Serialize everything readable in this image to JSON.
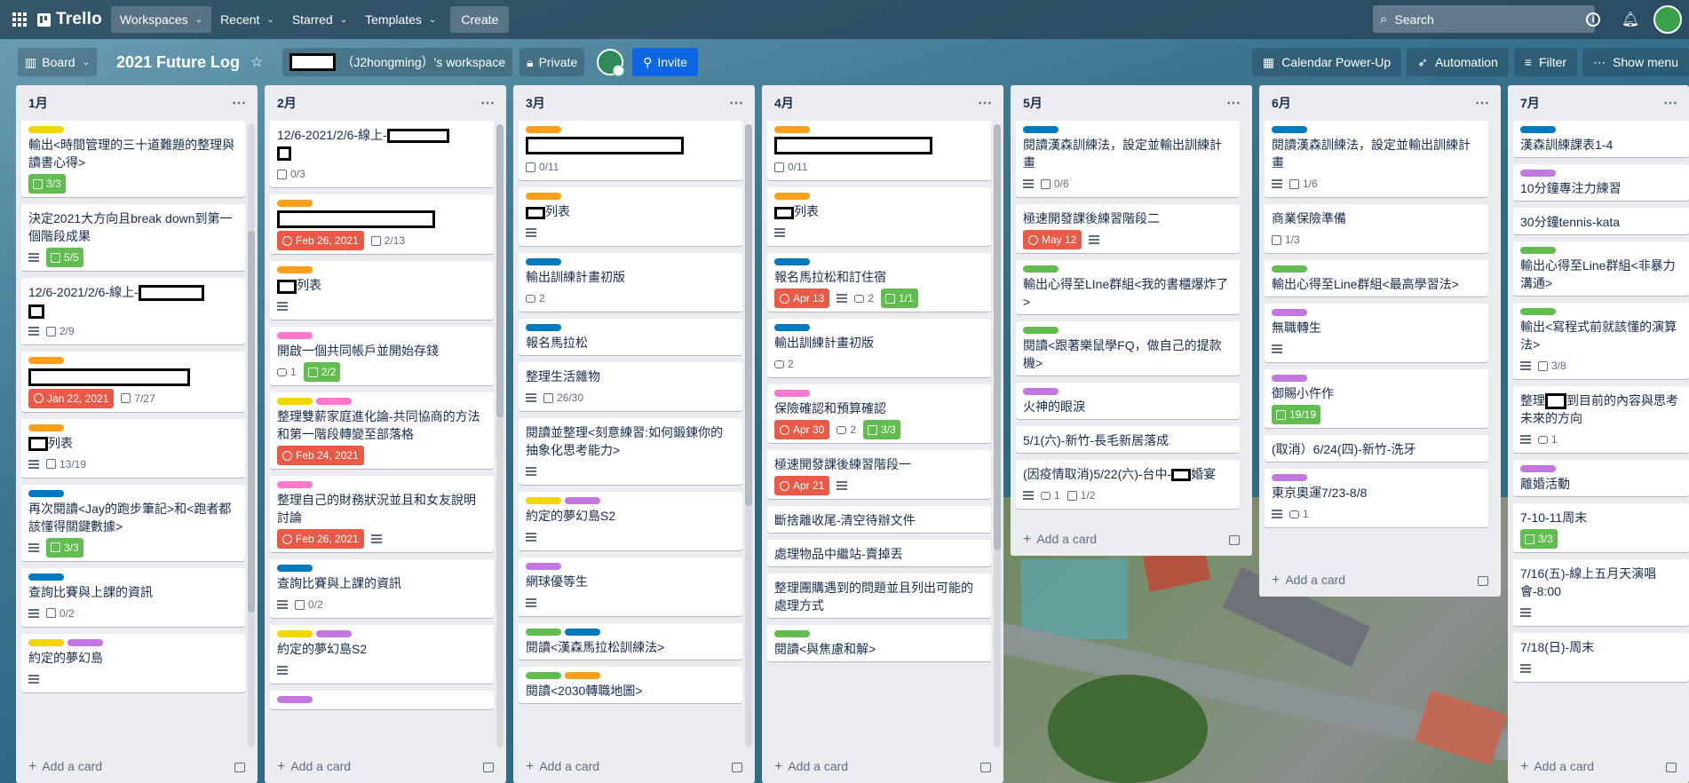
{
  "header": {
    "app_name": "Trello",
    "nav": [
      "Workspaces",
      "Recent",
      "Starred",
      "Templates"
    ],
    "create_label": "Create",
    "search_placeholder": "Search"
  },
  "board": {
    "view_label": "Board",
    "title": "2021 Future Log",
    "workspace_label": "（J2hongming）'s workspace",
    "visibility": "Private",
    "invite_label": "Invite",
    "right_buttons": [
      "Calendar Power-Up",
      "Automation",
      "Filter",
      "Show menu"
    ]
  },
  "add_card_label": "Add a card",
  "colors": {
    "orange": "#ff9f1a",
    "yellow": "#f2d600",
    "blue": "#0079bf",
    "green": "#61bd4f",
    "purple": "#c377e0",
    "pink": "#ff78cb",
    "red": "#eb5a46"
  },
  "lists": [
    {
      "title": "1月",
      "cards": [
        {
          "labels": [
            "yellow"
          ],
          "title": "輸出<時間管理的三十道難題的整理與讀書心得>",
          "checklist": "3/3",
          "checklist_done": true
        },
        {
          "labels": [],
          "title": "決定2021大方向且break down到第一個階段成果",
          "desc": true,
          "checklist": "5/5",
          "checklist_done": true
        },
        {
          "labels": [],
          "title": "12/6-2021/2/6-線上-",
          "redacted": [
            74,
            18
          ],
          "redacted2": [
            18,
            16
          ],
          "desc": true,
          "checklist": "2/9"
        },
        {
          "labels": [
            "orange"
          ],
          "title": "",
          "redacted_full": [
            182,
            18
          ],
          "due": "Jan 22, 2021",
          "checklist": "7/27"
        },
        {
          "labels": [
            "orange"
          ],
          "title": "列表",
          "redacted_pre": [
            22,
            16
          ],
          "desc": true,
          "checklist": "13/19"
        },
        {
          "labels": [
            "blue"
          ],
          "title": "再次閱讀<Jay的跑步筆記>和<跑者都該懂得關鍵數據>",
          "desc": true,
          "checklist": "3/3",
          "checklist_done": true
        },
        {
          "labels": [
            "blue"
          ],
          "title": "查詢比賽與上課的資訊",
          "desc": true,
          "checklist": "0/2"
        },
        {
          "labels": [
            "yellow",
            "purple"
          ],
          "title": "約定的夢幻島",
          "desc": true
        }
      ]
    },
    {
      "title": "2月",
      "cards": [
        {
          "labels": [],
          "title": "12/6-2021/2/6-線上-",
          "redacted": [
            70,
            16
          ],
          "redacted2": [
            16,
            16
          ],
          "checklist": "0/3"
        },
        {
          "labels": [
            "orange"
          ],
          "title": "",
          "redacted_full": [
            178,
            16
          ],
          "due": "Feb 26, 2021",
          "checklist": "2/13"
        },
        {
          "labels": [
            "orange"
          ],
          "title": "列表",
          "redacted_pre": [
            22,
            16
          ],
          "desc": true
        },
        {
          "labels": [
            "pink"
          ],
          "title": "開啟一個共同帳戶並開始存錢",
          "comments": "1",
          "checklist": "2/2",
          "checklist_done": true
        },
        {
          "labels": [
            "yellow",
            "pink"
          ],
          "title": "整理雙薪家庭進化論-共同協商的方法和第一階段轉變至部落格",
          "due": "Feb 24, 2021"
        },
        {
          "labels": [
            "pink"
          ],
          "title": "整理自己的財務狀況並且和女友說明討論",
          "due": "Feb 26, 2021",
          "desc": true
        },
        {
          "labels": [
            "blue"
          ],
          "title": "查詢比賽與上課的資訊",
          "desc": true,
          "checklist": "0/2"
        },
        {
          "labels": [
            "yellow",
            "purple"
          ],
          "title": "約定的夢幻島S2",
          "desc": true
        },
        {
          "labels": [
            "purple"
          ],
          "title": ""
        }
      ]
    },
    {
      "title": "3月",
      "cards": [
        {
          "labels": [
            "orange"
          ],
          "title": "",
          "redacted_full": [
            178,
            16
          ],
          "checklist": "0/11"
        },
        {
          "labels": [
            "orange"
          ],
          "title": "列表",
          "redacted_pre": [
            22,
            14
          ],
          "desc": true
        },
        {
          "labels": [
            "blue"
          ],
          "title": "輸出訓練計畫初版",
          "comments": "2"
        },
        {
          "labels": [
            "blue"
          ],
          "title": "報名馬拉松"
        },
        {
          "labels": [],
          "title": "整理生活雜物",
          "desc": true,
          "checklist": "26/30"
        },
        {
          "labels": [],
          "title": "閱讀並整理<刻意練習:如何鍛鍊你的抽象化思考能力>",
          "desc": true
        },
        {
          "labels": [
            "yellow",
            "purple"
          ],
          "title": "約定的夢幻島S2",
          "desc": true
        },
        {
          "labels": [
            "purple"
          ],
          "title": "網球優等生",
          "desc": true
        },
        {
          "labels": [
            "green",
            "blue"
          ],
          "title": "閱讀<漢森馬拉松訓練法>"
        },
        {
          "labels": [
            "green",
            "orange"
          ],
          "title": "閱讀<2030轉職地圖>"
        }
      ]
    },
    {
      "title": "4月",
      "cards": [
        {
          "labels": [
            "orange"
          ],
          "title": "",
          "redacted_full": [
            178,
            16
          ],
          "checklist": "0/11"
        },
        {
          "labels": [
            "orange"
          ],
          "title": "列表",
          "redacted_pre": [
            22,
            14
          ],
          "desc": true
        },
        {
          "labels": [
            "blue"
          ],
          "title": "報名馬拉松和訂住宿",
          "due": "Apr 13",
          "desc": true,
          "comments": "2",
          "checklist": "1/1",
          "checklist_done": true
        },
        {
          "labels": [
            "blue"
          ],
          "title": "輸出訓練計畫初版",
          "comments": "2"
        },
        {
          "labels": [
            "pink"
          ],
          "title": "保險確認和預算確認",
          "due": "Apr 30",
          "comments": "2",
          "checklist": "3/3",
          "checklist_done": true
        },
        {
          "labels": [],
          "title": "極速開發課後練習階段一",
          "due": "Apr 21",
          "desc": true
        },
        {
          "labels": [],
          "title": "斷捨離收尾-清空待辦文件"
        },
        {
          "labels": [],
          "title": "處理物品中繼站-賣掉丟"
        },
        {
          "labels": [],
          "title": "整理團購遇到的問題並且列出可能的處理方式"
        },
        {
          "labels": [
            "green"
          ],
          "title": "閱讀<與焦慮和解>"
        }
      ]
    },
    {
      "title": "5月",
      "cards": [
        {
          "labels": [
            "blue"
          ],
          "title": "閱讀漢森訓練法，設定並輸出訓練計畫",
          "desc": true,
          "checklist": "0/6"
        },
        {
          "labels": [],
          "title": "極速開發課後練習階段二",
          "due": "May 12",
          "desc": true
        },
        {
          "labels": [
            "green"
          ],
          "title": "輸出心得至LIne群組<我的書櫃爆炸了>"
        },
        {
          "labels": [
            "green"
          ],
          "title": "閱讀<跟著樂鼠學FQ，做自己的提款機>"
        },
        {
          "labels": [
            "purple"
          ],
          "title": "火神的眼淚"
        },
        {
          "labels": [],
          "title": "5/1(六)-新竹-長毛新居落成"
        },
        {
          "labels": [],
          "title": "(因疫情取消)5/22(六)-台中-",
          "title_after": "婚宴",
          "redacted_mid": [
            22,
            14
          ],
          "desc": true,
          "comments": "1",
          "checklist": "1/2"
        }
      ]
    },
    {
      "title": "6月",
      "cards": [
        {
          "labels": [
            "blue"
          ],
          "title": "閱讀漢森訓練法，設定並輸出訓練計畫",
          "desc": true,
          "checklist": "1/6"
        },
        {
          "labels": [],
          "title": "商業保險準備",
          "checklist": "1/3"
        },
        {
          "labels": [
            "green"
          ],
          "title": "輸出心得至Line群組<最高學習法>"
        },
        {
          "labels": [
            "purple"
          ],
          "title": "無職轉生",
          "desc": true
        },
        {
          "labels": [
            "purple"
          ],
          "title": "御賜小仵作",
          "checklist": "19/19",
          "checklist_done": true
        },
        {
          "labels": [],
          "title": "(取消）6/24(四)-新竹-洗牙"
        },
        {
          "labels": [
            "purple"
          ],
          "title": "東京奧運7/23-8/8",
          "desc": true,
          "comments": "1"
        }
      ]
    },
    {
      "title": "7月",
      "cards": [
        {
          "labels": [
            "blue"
          ],
          "title": "漢森訓練課表1-4"
        },
        {
          "labels": [
            "purple"
          ],
          "title": "10分鐘專注力練習"
        },
        {
          "labels": [],
          "title": "30分鐘tennis-kata"
        },
        {
          "labels": [
            "green"
          ],
          "title": "輸出心得至Line群組<非暴力溝通>"
        },
        {
          "labels": [
            "green"
          ],
          "title": "輸出<寫程式前就該懂的演算法>",
          "desc": true,
          "checklist": "3/8"
        },
        {
          "labels": [],
          "title": "整理",
          "title_after": "到目前的內容與思考未來的方向",
          "redacted_mid": [
            24,
            18
          ],
          "desc": true,
          "comments": "1"
        },
        {
          "labels": [
            "purple"
          ],
          "title": "離婚活動"
        },
        {
          "labels": [],
          "title": "7-10-11周末",
          "checklist": "3/3",
          "checklist_done": true
        },
        {
          "labels": [],
          "title": "7/16(五)-線上五月天演唱會-8:00",
          "desc": true
        },
        {
          "labels": [],
          "title": "7/18(日)-周末",
          "desc": true
        }
      ]
    }
  ]
}
